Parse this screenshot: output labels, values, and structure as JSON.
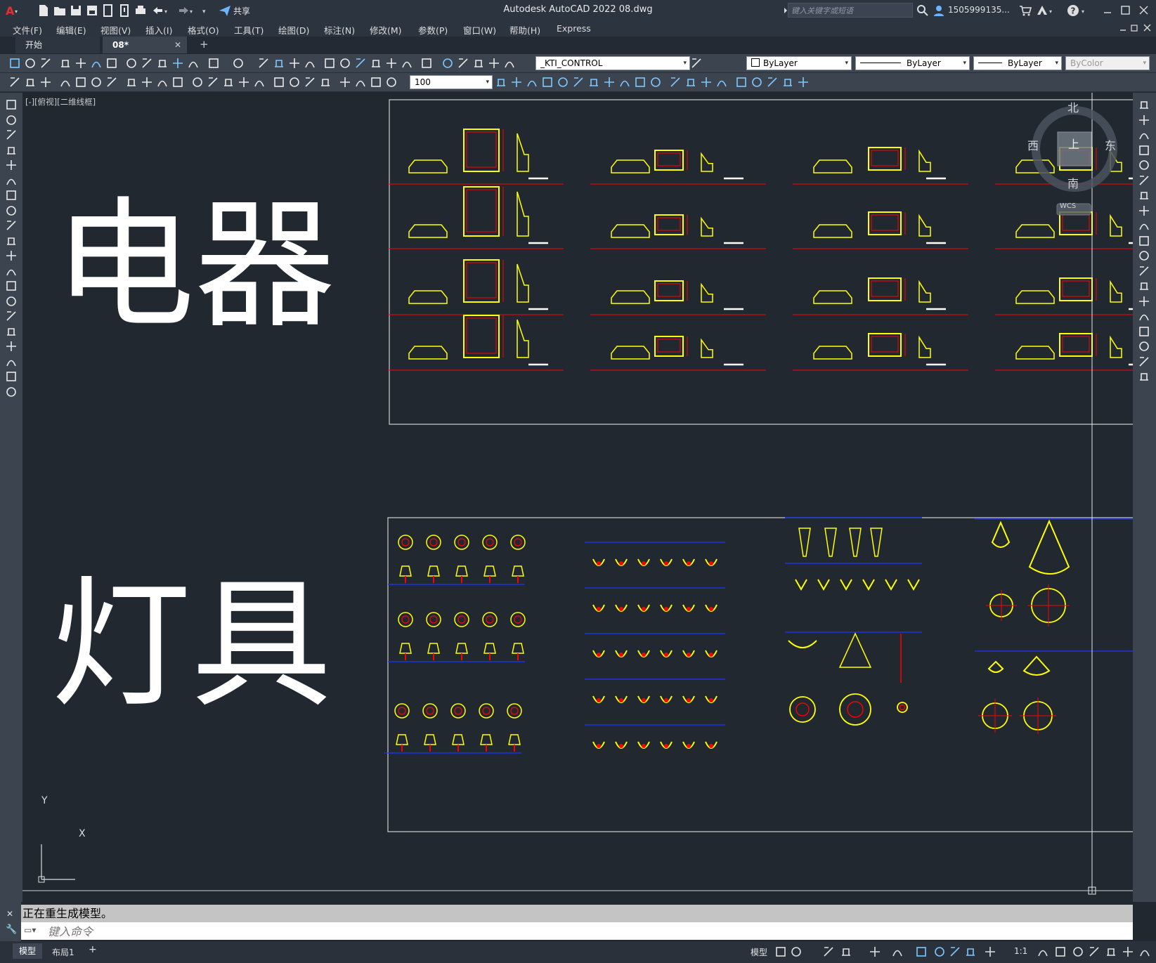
{
  "app": {
    "title": "Autodesk AutoCAD 2022    08.dwg",
    "share_label": "共享",
    "search_placeholder": "键入关键字或短语",
    "user": "1505999135..."
  },
  "menus": [
    "文件(F)",
    "编辑(E)",
    "视图(V)",
    "插入(I)",
    "格式(O)",
    "工具(T)",
    "绘图(D)",
    "标注(N)",
    "修改(M)",
    "参数(P)",
    "窗口(W)",
    "帮助(H)",
    "Express"
  ],
  "tabs": {
    "start": "开始",
    "doc": "08*",
    "add": "+"
  },
  "toolbar": {
    "layer": "_KTI_CONTROL",
    "color": "ByLayer",
    "linetype": "ByLayer",
    "lineweight": "ByLayer",
    "plotstyle": "ByColor",
    "scale": "100"
  },
  "viewport": {
    "label": "[-][俯视][二维线框]"
  },
  "drawing": {
    "title_1": "电器",
    "title_2": "灯具"
  },
  "viewcube": {
    "north": "北",
    "south": "南",
    "east": "东",
    "west": "西",
    "top": "上",
    "wcs": "WCS"
  },
  "ucs": {
    "x": "X",
    "y": "Y"
  },
  "command": {
    "history": "正在重生成模型。",
    "placeholder": "键入命令"
  },
  "layout_tabs": {
    "model": "模型",
    "layout1": "布局1",
    "add": "+"
  },
  "status": {
    "model": "模型",
    "scale": "1:1"
  },
  "colors": {
    "bg": "#212830",
    "yellow": "#ffff00",
    "red": "#ff0000",
    "blue": "#1a35ff"
  }
}
